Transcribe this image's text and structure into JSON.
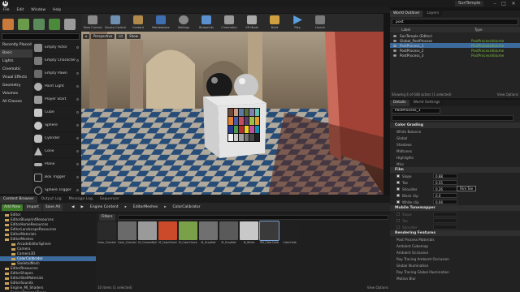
{
  "window": {
    "project": "SunTemple",
    "controls": [
      "–",
      "□",
      "✕"
    ]
  },
  "menu": [
    "File",
    "Edit",
    "Window",
    "Help"
  ],
  "place": {
    "categories": [
      "Recently Placed",
      "Basic",
      "Lights",
      "Cinematic",
      "Visual Effects",
      "Geometry",
      "Volumes",
      "All Classes"
    ],
    "active_category": "Basic",
    "actors": [
      "Empty Actor",
      "Empty Character",
      "Empty Pawn",
      "Point Light",
      "Player Start",
      "Cube",
      "Sphere",
      "Cylinder",
      "Cone",
      "Plane",
      "Box Trigger",
      "Sphere Trigger"
    ]
  },
  "toolbar": [
    {
      "label": "Save Current",
      "color": "#8a8a8a"
    },
    {
      "label": "Source Control",
      "color": "#6f8fb0"
    },
    {
      "label": "Content",
      "color": "#b08a4a"
    },
    {
      "label": "Marketplace",
      "color": "#3f6fb0"
    },
    {
      "label": "Settings",
      "color": "#888888"
    },
    {
      "label": "Blueprints",
      "color": "#5a8fd0"
    },
    {
      "label": "Cinematics",
      "color": "#9a9a9a"
    },
    {
      "label": "VR Mode",
      "color": "#aaaaaa"
    },
    {
      "label": "Build",
      "color": "#d0a040"
    },
    {
      "label": "Play",
      "color": "#5aa0e0"
    },
    {
      "label": "Launch",
      "color": "#7a7a7a"
    }
  ],
  "viewport": {
    "buttons": [
      "Perspective",
      "Lit",
      "Show"
    ]
  },
  "outliner": {
    "tabs": [
      "World Outliner",
      "Layers"
    ],
    "search_value": "post",
    "columns": [
      "Label",
      "Type"
    ],
    "rows": [
      {
        "name": "SunTemple (Editor)",
        "type": "",
        "state": "normal"
      },
      {
        "name": "Global_PostProcess",
        "type": "PostProcessVolume",
        "state": "normal"
      },
      {
        "name": "PostProcess_1",
        "type": "PostProcessVolume",
        "state": "selected"
      },
      {
        "name": "PostProcess_2",
        "type": "PostProcessVolume",
        "state": "normal"
      },
      {
        "name": "PostProcess_3",
        "type": "PostProcessVolume",
        "state": "normal"
      }
    ],
    "footer": "Showing 4 of 648 actors (1 selected)",
    "view_options": "View Options"
  },
  "details": {
    "tabs": [
      "Details",
      "World Settings"
    ],
    "actor_name": "PostProcess_1",
    "sections": [
      {
        "title": "Color Grading",
        "props": [
          "White Balance",
          "Global",
          "Shadows",
          "Midtones",
          "Highlights",
          "Misc"
        ]
      },
      {
        "title": "Film",
        "props": [
          {
            "name": "Slope",
            "value": "0.88",
            "checked": true
          },
          {
            "name": "Toe",
            "value": "0.55",
            "checked": true
          },
          {
            "name": "Shoulder",
            "value": "0.26",
            "checked": true
          },
          {
            "name": "Black clip",
            "value": "0.0",
            "checked": true
          },
          {
            "name": "White clip",
            "value": "0.04",
            "checked": true
          }
        ],
        "tooltip": "Film Toe"
      },
      {
        "title": "Mobile Tonemapper",
        "props": [
          {
            "name": "Slope",
            "value": ""
          },
          {
            "name": "Toe",
            "value": ""
          },
          {
            "name": "Shoulder",
            "value": ""
          }
        ]
      },
      {
        "title": "Rendering Features",
        "props": [
          "Post Process Materials",
          "Ambient Cubemap",
          "Ambient Occlusion",
          "Ray Tracing Ambient Occlusion",
          "Global Illumination",
          "Ray Tracing Global Illumination",
          "Motion Blur"
        ]
      }
    ]
  },
  "content_browser": {
    "tabs": [
      "Content Browser",
      "Output Log",
      "Message Log",
      "Sequencer"
    ],
    "add_new": "Add New",
    "import": "Import",
    "save_all": "Save All",
    "breadcrumb": [
      "Engine Content",
      "EditorMeshes",
      "ColorCalibrator"
    ],
    "filters": "Filters",
    "tree": [
      "Editor",
      "EditorBlueprintResources",
      "EditorHomeResources",
      "EditorLandscapeResources",
      "EditorMaterials",
      "EditorMeshes",
      "ArcadeEditorSphere",
      "Camera",
      "Camera3D",
      "ColorCalibrator",
      "SkeletalMesh",
      "EditorResources",
      "EditorShapes",
      "EditorSkelMaterials",
      "EditorSounds",
      "Engine_MI_Shaders",
      "EngineDamageTypes"
    ],
    "tree_selected": "ColorCalibrator",
    "assets": [
      {
        "name": "Color_Checker",
        "color": "#2a2a2a"
      },
      {
        "name": "Color_Checker_Mat",
        "color": "#6a6a6a"
      },
      {
        "name": "M_ChromeBall",
        "color": "#9a9a9a"
      },
      {
        "name": "M_ColorCheck",
        "color": "#cc4a2a"
      },
      {
        "name": "M_ColorCheck_Base",
        "color": "#7aa04a"
      },
      {
        "name": "M_GrayBall",
        "color": "#707070"
      },
      {
        "name": "M_GrayBall",
        "color": "#5a5a5a"
      },
      {
        "name": "M_White",
        "color": "#c8c8c8"
      },
      {
        "name": "SM_ColorCalibrator",
        "color": "#3a3a3a"
      },
      {
        "name": "ColorCalib",
        "color": "#202020"
      }
    ],
    "footer": "10 items (1 selected)",
    "view_options": "View Options"
  }
}
